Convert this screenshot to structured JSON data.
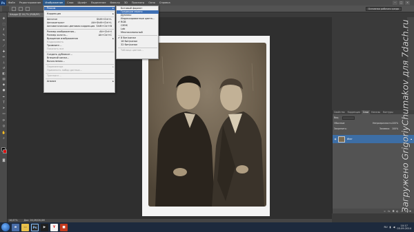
{
  "menubar": {
    "logo": "Ps",
    "items": [
      "Файл",
      "Редактирование",
      "Изображение",
      "Слои",
      "Шрифт",
      "Выделение",
      "Фильтр",
      "3D",
      "Просмотр",
      "Окно",
      "Справка"
    ],
    "active_index": 2
  },
  "optionsbar": {
    "workspace": "Основная рабочая среда"
  },
  "document": {
    "tab_title": "Шаддо @ 16,7% (RGB/8*)",
    "zoom": "16,67%",
    "doc_size": "Док: 26,0M/26,0M"
  },
  "image_menu": {
    "rows": [
      {
        "label": "Режим",
        "shortcut": "",
        "submenu": true,
        "highlighted": true,
        "disabled": false
      },
      {
        "sep": true
      },
      {
        "label": "Коррекция",
        "shortcut": "",
        "submenu": true,
        "highlighted": false,
        "disabled": false
      },
      {
        "sep": true
      },
      {
        "label": "Автотон",
        "shortcut": "Shift+Ctrl+L",
        "submenu": false,
        "highlighted": false,
        "disabled": false
      },
      {
        "label": "Автоконтраст",
        "shortcut": "Alt+Shift+Ctrl+L",
        "submenu": false,
        "highlighted": false,
        "disabled": false
      },
      {
        "label": "Автоматическая цветовая коррекция",
        "shortcut": "Shift+Ctrl+B",
        "submenu": false,
        "highlighted": false,
        "disabled": false
      },
      {
        "sep": true
      },
      {
        "label": "Размер изображения...",
        "shortcut": "Alt+Ctrl+I",
        "submenu": false,
        "highlighted": false,
        "disabled": false
      },
      {
        "label": "Размер холста...",
        "shortcut": "Alt+Ctrl+C",
        "submenu": false,
        "highlighted": false,
        "disabled": false
      },
      {
        "label": "Вращение изображения",
        "shortcut": "",
        "submenu": true,
        "highlighted": false,
        "disabled": false
      },
      {
        "label": "Кадрировать",
        "shortcut": "",
        "submenu": false,
        "highlighted": false,
        "disabled": true
      },
      {
        "label": "Тримминг...",
        "shortcut": "",
        "submenu": false,
        "highlighted": false,
        "disabled": false
      },
      {
        "label": "Показать все",
        "shortcut": "",
        "submenu": false,
        "highlighted": false,
        "disabled": true
      },
      {
        "sep": true
      },
      {
        "label": "Создать дубликат...",
        "shortcut": "",
        "submenu": false,
        "highlighted": false,
        "disabled": false
      },
      {
        "label": "Внешний канал...",
        "shortcut": "",
        "submenu": false,
        "highlighted": false,
        "disabled": false
      },
      {
        "label": "Вычисления...",
        "shortcut": "",
        "submenu": false,
        "highlighted": false,
        "disabled": false
      },
      {
        "sep": true
      },
      {
        "label": "Переменные",
        "shortcut": "",
        "submenu": true,
        "highlighted": false,
        "disabled": true
      },
      {
        "label": "Применить набор данных...",
        "shortcut": "",
        "submenu": false,
        "highlighted": false,
        "disabled": true
      },
      {
        "sep": true
      },
      {
        "label": "Треппинг...",
        "shortcut": "",
        "submenu": false,
        "highlighted": false,
        "disabled": true
      },
      {
        "sep": true
      },
      {
        "label": "Анализ",
        "shortcut": "",
        "submenu": true,
        "highlighted": false,
        "disabled": false
      }
    ]
  },
  "mode_submenu": {
    "rows": [
      {
        "label": "Битовый формат",
        "checked": false,
        "highlighted": false,
        "disabled": false
      },
      {
        "label": "Градации серого",
        "checked": false,
        "highlighted": true,
        "disabled": false
      },
      {
        "label": "Дуплекс",
        "checked": false,
        "highlighted": false,
        "disabled": false
      },
      {
        "label": "Индексированные цвета...",
        "checked": false,
        "highlighted": false,
        "disabled": false
      },
      {
        "label": "RGB",
        "checked": true,
        "highlighted": false,
        "disabled": false
      },
      {
        "label": "CMYK",
        "checked": false,
        "highlighted": false,
        "disabled": false
      },
      {
        "label": "Lab",
        "checked": false,
        "highlighted": false,
        "disabled": false
      },
      {
        "label": "Многоканальный",
        "checked": false,
        "highlighted": false,
        "disabled": false
      },
      {
        "sep": true
      },
      {
        "label": "8 бит/канал",
        "checked": true,
        "highlighted": false,
        "disabled": false
      },
      {
        "label": "16 бит/канал",
        "checked": false,
        "highlighted": false,
        "disabled": false
      },
      {
        "label": "32 бит/канал",
        "checked": false,
        "highlighted": false,
        "disabled": false
      },
      {
        "sep": true
      },
      {
        "label": "Таблица цветов...",
        "checked": false,
        "highlighted": false,
        "disabled": true
      }
    ]
  },
  "layers_panel": {
    "tabs": [
      "Свойства",
      "Коррекция",
      "Слои",
      "Каналы",
      "Контуры"
    ],
    "active_tab": 2,
    "kind_filter": "Вид",
    "blend_mode": "Обычные",
    "opacity_label": "Непрозрачность:",
    "opacity_value": "100%",
    "lock_label": "Закрепить:",
    "fill_label": "Заливка:",
    "fill_value": "100%",
    "layer_name": "Фон"
  },
  "taskbar": {
    "lang": "RU",
    "time": "10:17",
    "date": "05.09.2014"
  },
  "watermark": "Загружено GrigoriyChumakov для 7dach.ru"
}
